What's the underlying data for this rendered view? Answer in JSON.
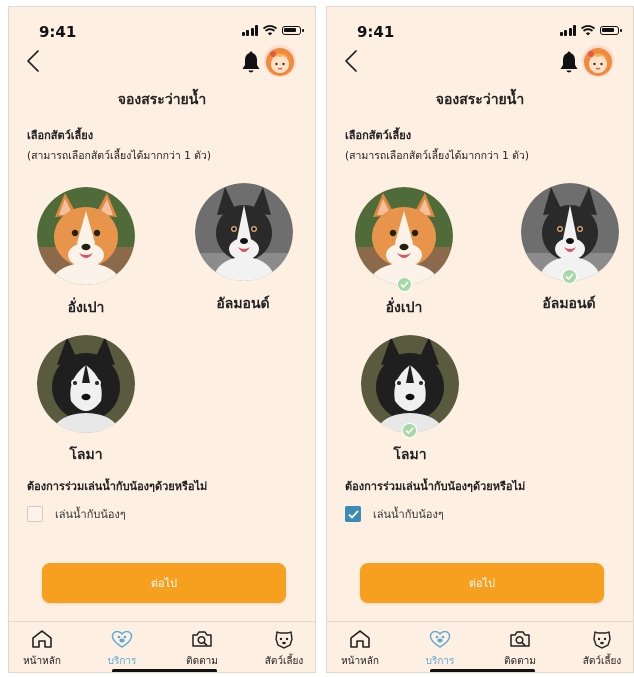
{
  "status_bar": {
    "time": "9:41"
  },
  "header": {
    "title": "จองสระว่ายน้ำ"
  },
  "select_pets": {
    "label": "เลือกสัตว์เลี้ยง",
    "sublabel": "(สามารถเลือกสัตว์เลี้ยงได้มากกว่า 1 ตัว)"
  },
  "pets": [
    {
      "name": "อั่งเปา",
      "breed": "corgi"
    },
    {
      "name": "อัลมอนด์",
      "breed": "corgi-tricolor"
    },
    {
      "name": "โลมา",
      "breed": "husky"
    }
  ],
  "swim_question": "ต้องการร่วมเล่นน้ำกับน้องๆด้วยหรือไม่",
  "swim_option_label": "เล่นน้ำกับน้องๆ",
  "next_label": "ต่อไป",
  "tabs": [
    {
      "label": "หน้าหลัก",
      "icon": "home-icon"
    },
    {
      "label": "บริการ",
      "icon": "paw-heart-icon"
    },
    {
      "label": "ติดตาม",
      "icon": "camera-search-icon"
    },
    {
      "label": "สัตว์เลี้ยง",
      "icon": "dog-face-icon"
    }
  ],
  "screens": [
    {
      "state": "unselected",
      "pets_selected": [
        false,
        false,
        false
      ],
      "swim_checked": false,
      "active_tab": "บริการ"
    },
    {
      "state": "selected",
      "pets_selected": [
        true,
        true,
        true
      ],
      "swim_checked": true,
      "active_tab": "บริการ"
    }
  ],
  "colors": {
    "background": "#fdefe2",
    "accent": "#f7a020",
    "active_tab": "#5aa9d6",
    "check_badge": "#a6d9a6",
    "checkbox_checked": "#3b8bb5"
  }
}
